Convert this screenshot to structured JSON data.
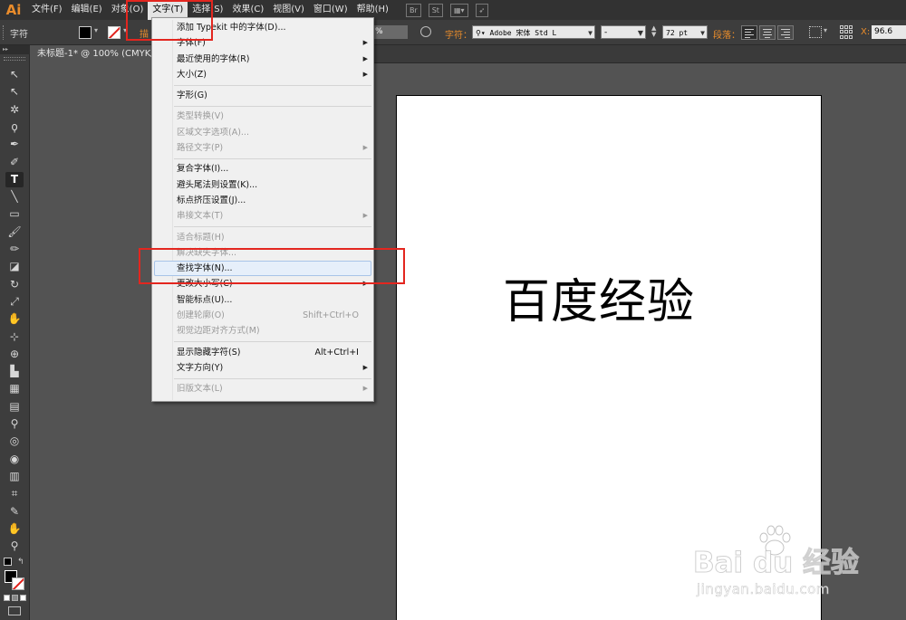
{
  "app": {
    "logo": "Ai"
  },
  "menubar": {
    "items": [
      "文件(F)",
      "编辑(E)",
      "对象(O)",
      "文字(T)",
      "选择(S)",
      "效果(C)",
      "视图(V)",
      "窗口(W)",
      "帮助(H)"
    ],
    "active_index": 3,
    "icons": [
      {
        "name": "bridge-icon",
        "label": "Br"
      },
      {
        "name": "stock-icon",
        "label": "St"
      },
      {
        "name": "arrange-documents-icon",
        "label": "▦▾"
      },
      {
        "name": "sync-icon",
        "label": "➶"
      }
    ]
  },
  "controlbar": {
    "label": "字符",
    "stroke_label": "描",
    "opacity": "%",
    "char_label": "字符：",
    "font_family": "Adobe 宋体 Std L",
    "font_style": "-",
    "font_size": "72 pt",
    "paragraph_label": "段落：",
    "x_label": "X:",
    "x_value": "96.6"
  },
  "doc_tab": {
    "title": "未标题-1* @ 100% (CMYK/"
  },
  "toolbox": {
    "header": "▸▸",
    "tools": [
      {
        "name": "selection-tool",
        "glyph": "↖"
      },
      {
        "name": "direct-selection-tool",
        "glyph": "↖"
      },
      {
        "name": "magic-wand-tool",
        "glyph": "✲"
      },
      {
        "name": "lasso-tool",
        "glyph": "ϙ"
      },
      {
        "name": "pen-tool",
        "glyph": "✒"
      },
      {
        "name": "curvature-tool",
        "glyph": "✐"
      },
      {
        "name": "type-tool",
        "glyph": "T"
      },
      {
        "name": "line-tool",
        "glyph": "╲"
      },
      {
        "name": "rectangle-tool",
        "glyph": "▭"
      },
      {
        "name": "paintbrush-tool",
        "glyph": "🖌"
      },
      {
        "name": "pencil-tool",
        "glyph": "✏"
      },
      {
        "name": "eraser-tool",
        "glyph": "◪"
      },
      {
        "name": "rotate-tool",
        "glyph": "↻"
      },
      {
        "name": "scale-tool",
        "glyph": "⤢"
      },
      {
        "name": "warp-tool",
        "glyph": "✋"
      },
      {
        "name": "free-transform-tool",
        "glyph": "⊹"
      },
      {
        "name": "shape-builder-tool",
        "glyph": "⊕"
      },
      {
        "name": "perspective-grid-tool",
        "glyph": "▙"
      },
      {
        "name": "mesh-tool",
        "glyph": "▦"
      },
      {
        "name": "gradient-tool",
        "glyph": "▤"
      },
      {
        "name": "eyedropper-tool",
        "glyph": "⚲"
      },
      {
        "name": "blend-tool",
        "glyph": "◎"
      },
      {
        "name": "symbol-sprayer-tool",
        "glyph": "◉"
      },
      {
        "name": "column-graph-tool",
        "glyph": "▥"
      },
      {
        "name": "artboard-tool",
        "glyph": "⌗"
      },
      {
        "name": "slice-tool",
        "glyph": "✎"
      },
      {
        "name": "hand-tool",
        "glyph": "✋"
      },
      {
        "name": "zoom-tool",
        "glyph": "⚲"
      }
    ],
    "selected_tool": "type-tool"
  },
  "dropdown": {
    "groups": [
      [
        {
          "label": "添加 Typekit 中的字体(D)...",
          "enabled": true
        },
        {
          "label": "字体(F)",
          "enabled": true,
          "submenu": true
        },
        {
          "label": "最近使用的字体(R)",
          "enabled": true,
          "submenu": true
        },
        {
          "label": "大小(Z)",
          "enabled": true,
          "submenu": true
        }
      ],
      [
        {
          "label": "字形(G)",
          "enabled": true
        }
      ],
      [
        {
          "label": "类型转换(V)",
          "enabled": false
        },
        {
          "label": "区域文字选项(A)...",
          "enabled": false
        },
        {
          "label": "路径文字(P)",
          "enabled": false,
          "submenu": true
        }
      ],
      [
        {
          "label": "复合字体(I)...",
          "enabled": true
        },
        {
          "label": "避头尾法则设置(K)...",
          "enabled": true
        },
        {
          "label": "标点挤压设置(J)...",
          "enabled": true
        },
        {
          "label": "串接文本(T)",
          "enabled": false,
          "submenu": true
        }
      ],
      [
        {
          "label": "适合标题(H)",
          "enabled": false
        },
        {
          "label": "解决缺失字体...",
          "enabled": false
        },
        {
          "label": "查找字体(N)...",
          "enabled": true,
          "hover": true
        },
        {
          "label": "更改大小写(C)",
          "enabled": true,
          "submenu": true
        },
        {
          "label": "智能标点(U)...",
          "enabled": true
        },
        {
          "label": "创建轮廓(O)",
          "enabled": false,
          "shortcut": "Shift+Ctrl+O"
        },
        {
          "label": "视觉边距对齐方式(M)",
          "enabled": false
        }
      ],
      [
        {
          "label": "显示隐藏字符(S)",
          "enabled": true,
          "shortcut": "Alt+Ctrl+I"
        },
        {
          "label": "文字方向(Y)",
          "enabled": true,
          "submenu": true
        }
      ],
      [
        {
          "label": "旧版文本(L)",
          "enabled": false,
          "submenu": true
        }
      ]
    ]
  },
  "artboard": {
    "text": "百度经验"
  },
  "watermark": {
    "brand": "Bai du 经验",
    "url": "jingyan.baidu.com"
  },
  "colors": {
    "accent": "#e98c2b",
    "annotation": "#e3261f",
    "menu_bg": "#f0f0f0",
    "hover_bg": "#e6effa"
  }
}
